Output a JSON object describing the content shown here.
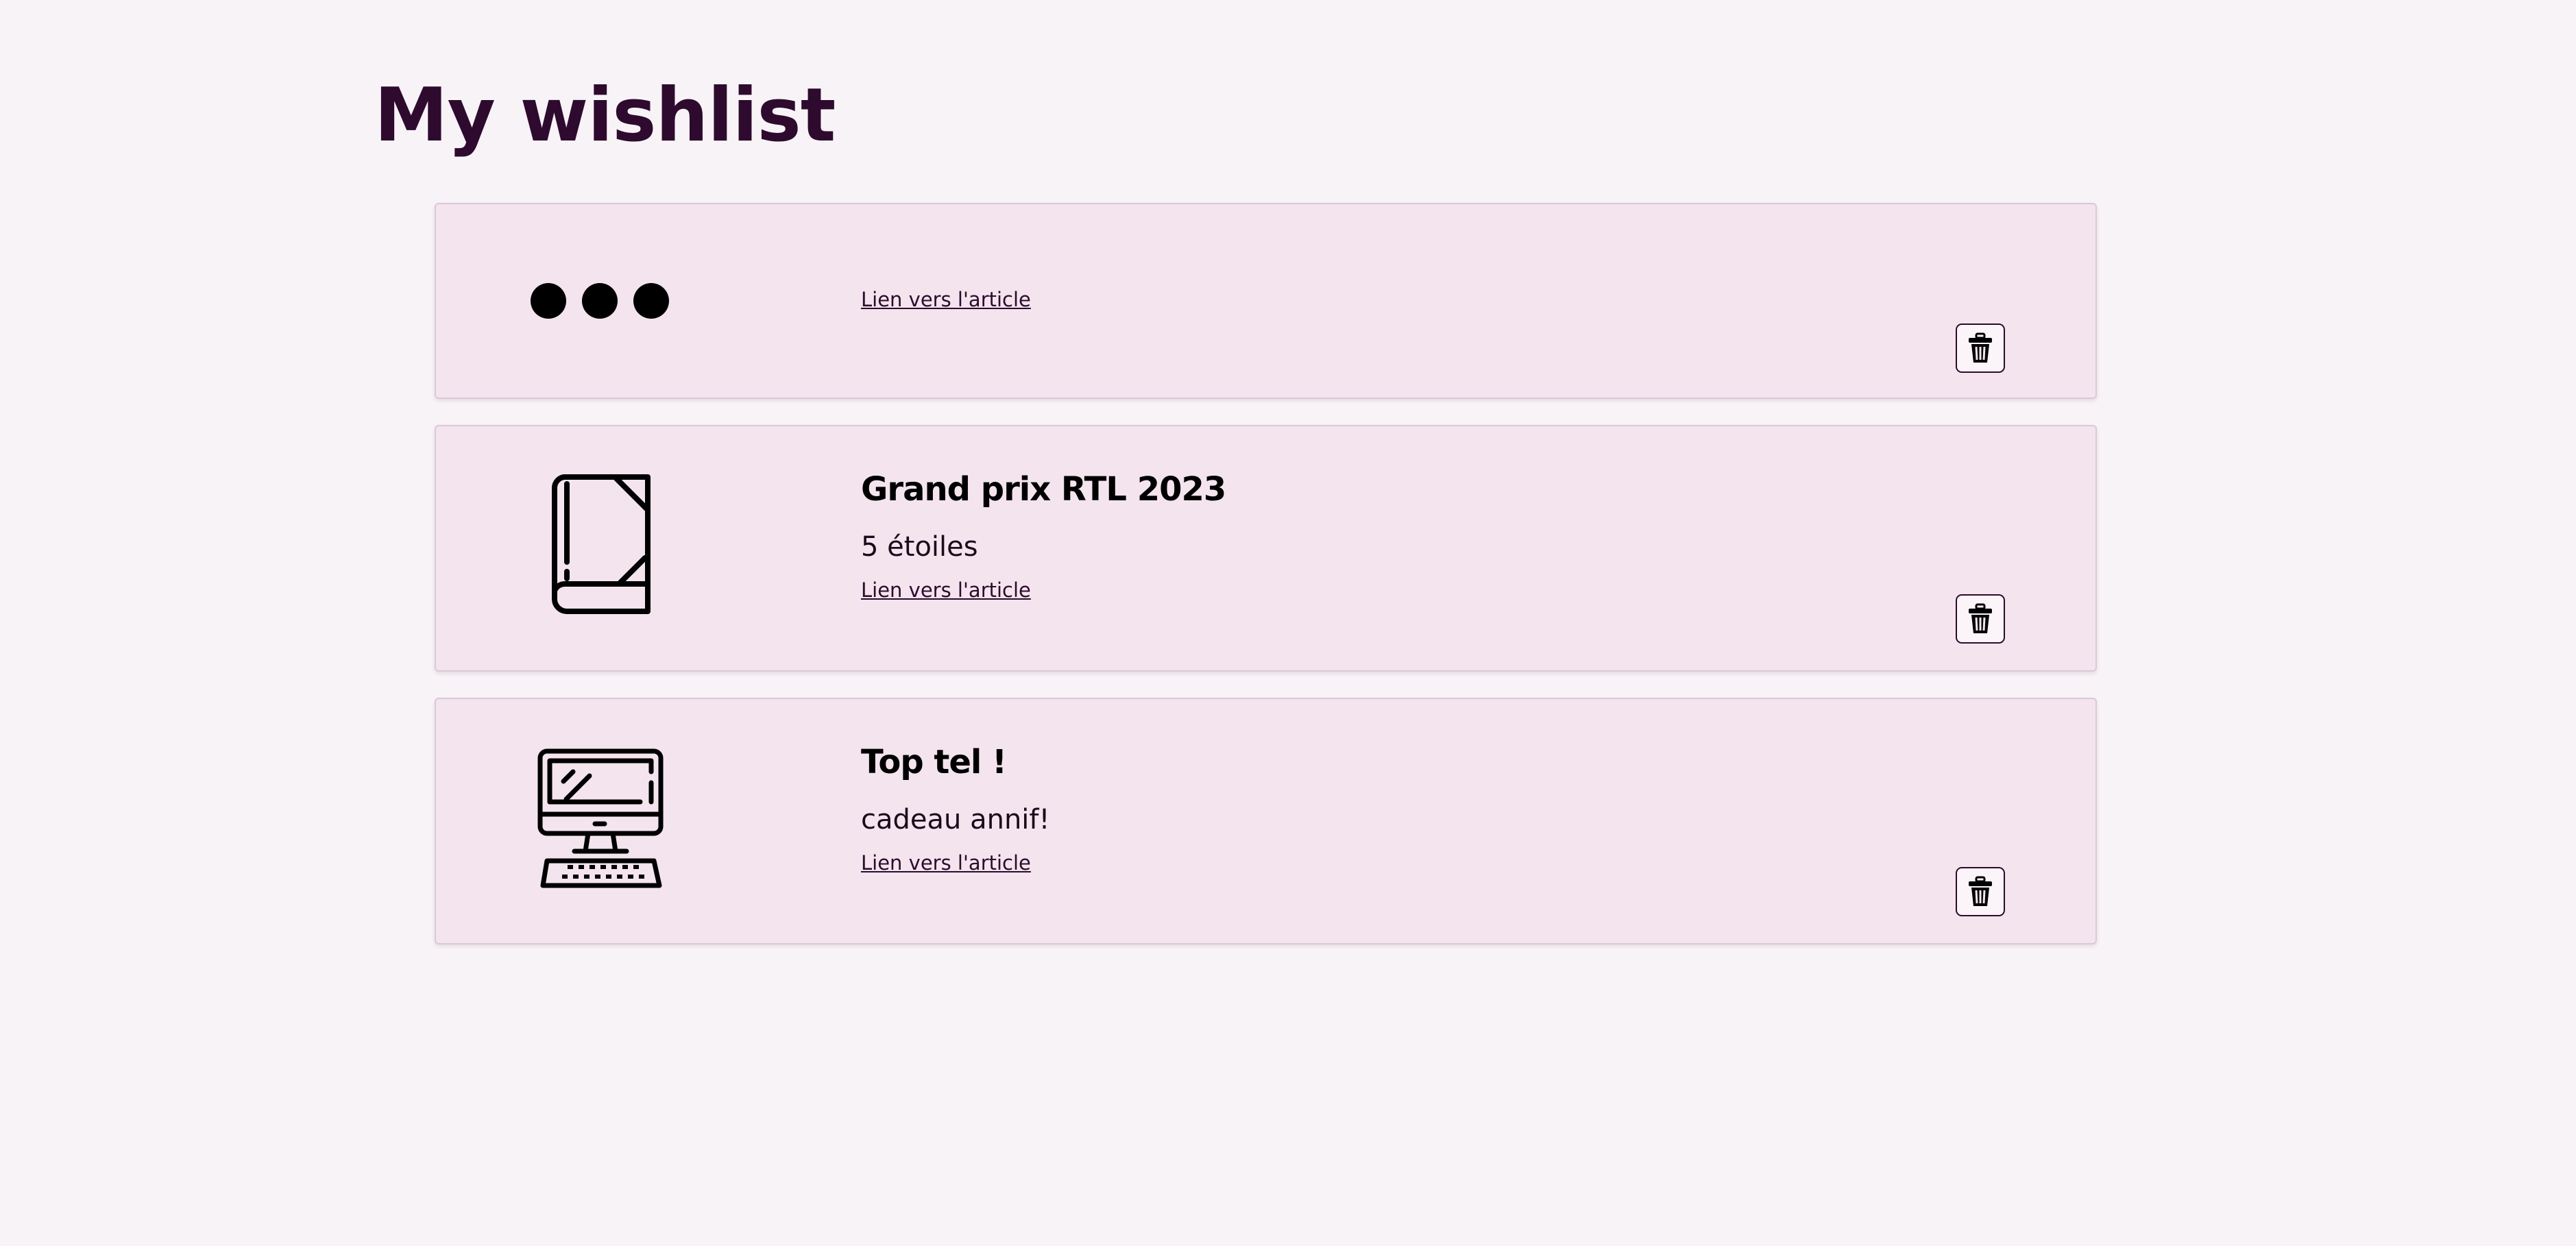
{
  "page": {
    "title": "My wishlist"
  },
  "wishlist": {
    "items": [
      {
        "icon": "dots-icon",
        "title": "",
        "description": "",
        "link_label": "Lien vers l'article",
        "delete_icon": "trash-icon"
      },
      {
        "icon": "book-icon",
        "title": "Grand prix RTL 2023",
        "description": "5 étoiles",
        "link_label": "Lien vers l'article",
        "delete_icon": "trash-icon"
      },
      {
        "icon": "computer-icon",
        "title": "Top tel !",
        "description": "cadeau annif!",
        "link_label": "Lien vers l'article",
        "delete_icon": "trash-icon"
      }
    ]
  },
  "colors": {
    "background": "#f8f3f7",
    "card": "#f3e4ee",
    "title": "#2e0b2e"
  }
}
